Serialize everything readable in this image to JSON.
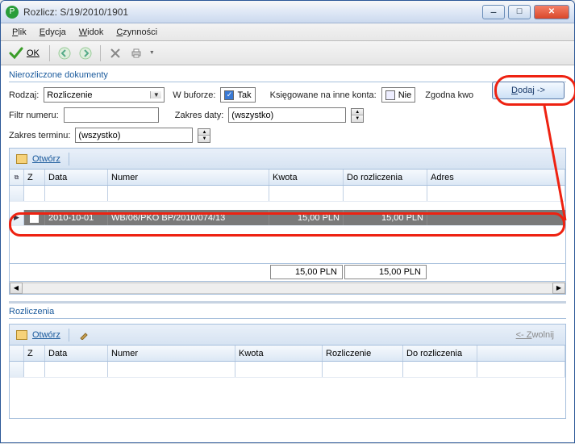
{
  "window": {
    "title": "Rozlicz: S/19/2010/1901"
  },
  "menu": {
    "plik": "Plik",
    "edycja": "Edycja",
    "widok": "Widok",
    "czynnosci": "Czynności"
  },
  "toolbar": {
    "ok": "OK"
  },
  "section1": {
    "title": "Nierozliczone dokumenty",
    "rodzaj_label": "Rodzaj:",
    "rodzaj_value": "Rozliczenie",
    "wbuforze_label": "W buforze:",
    "wbuforze_value": "Tak",
    "ksieg_label": "Księgowane na inne konta:",
    "ksieg_value": "Nie",
    "zgodna_label": "Zgodna kwo",
    "filtr_label": "Filtr numeru:",
    "zakres_daty_label": "Zakres daty:",
    "zakres_daty_value": "(wszystko)",
    "zakres_terminu_label": "Zakres terminu:",
    "zakres_terminu_value": "(wszystko)",
    "dodaj_label": "Dodaj ->"
  },
  "grid1": {
    "open": "Otwórz",
    "headers": {
      "z": "Z",
      "data": "Data",
      "numer": "Numer",
      "kwota": "Kwota",
      "dor": "Do rozliczenia",
      "adres": "Adres"
    },
    "rows": [
      {
        "data": "2010-10-01",
        "numer": "WB/06/PKO BP/2010/074/13",
        "kwota": "15,00 PLN",
        "dor": "15,00 PLN",
        "adres": ""
      }
    ],
    "footer": {
      "kwota": "15,00 PLN",
      "dor": "15,00 PLN"
    }
  },
  "section2": {
    "title": "Rozliczenia",
    "open": "Otwórz",
    "zwolnij": "<- Zwolnij",
    "headers": {
      "z": "Z",
      "data": "Data",
      "numer": "Numer",
      "kwota": "Kwota",
      "rozl": "Rozliczenie",
      "dor": "Do rozliczenia"
    }
  }
}
